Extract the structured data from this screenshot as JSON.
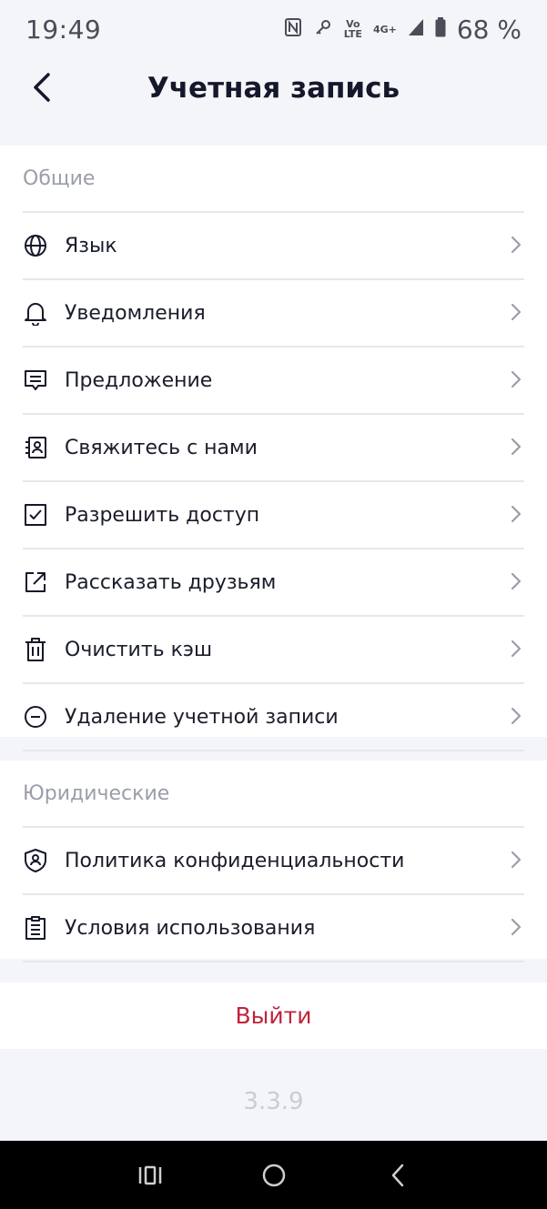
{
  "status_bar": {
    "time": "19:49",
    "volte_label_top": "Vo",
    "volte_label_bottom": "LTE",
    "network": "4G+",
    "battery": "68 %"
  },
  "header": {
    "title": "Учетная запись"
  },
  "sections": {
    "general": {
      "title": "Общие",
      "items": [
        {
          "label": "Язык",
          "icon": "globe-icon"
        },
        {
          "label": "Уведомления",
          "icon": "bell-icon"
        },
        {
          "label": "Предложение",
          "icon": "message-icon"
        },
        {
          "label": "Свяжитесь с нами",
          "icon": "contact-icon"
        },
        {
          "label": "Разрешить доступ",
          "icon": "checkbox-icon"
        },
        {
          "label": "Рассказать друзьям",
          "icon": "share-icon"
        },
        {
          "label": "Очистить кэш",
          "icon": "trash-icon"
        },
        {
          "label": "Удаление учетной записи",
          "icon": "minus-circle-icon"
        }
      ]
    },
    "legal": {
      "title": "Юридические",
      "items": [
        {
          "label": "Политика конфиденциальности",
          "icon": "shield-user-icon"
        },
        {
          "label": "Условия использования",
          "icon": "clipboard-icon"
        }
      ]
    }
  },
  "logout_label": "Выйти",
  "version": "3.3.9",
  "colors": {
    "background": "#f4f5f9",
    "card": "#ffffff",
    "text": "#15182a",
    "muted": "#9a9ea9",
    "logout": "#c0233a",
    "divider": "#e6e7ec"
  }
}
